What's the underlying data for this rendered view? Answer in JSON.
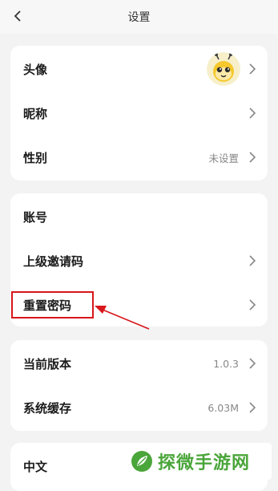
{
  "header": {
    "title": "设置"
  },
  "profile_card": {
    "avatar_label": "头像",
    "nickname_label": "昵称",
    "gender_label": "性别",
    "gender_value": "未设置"
  },
  "account_card": {
    "account_label": "账号",
    "invite_code_label": "上级邀请码",
    "reset_password_label": "重置密码"
  },
  "system_card": {
    "version_label": "当前版本",
    "version_value": "1.0.3",
    "cache_label": "系统缓存",
    "cache_value": "6.03M"
  },
  "language_card": {
    "language_label": "中文"
  },
  "watermark": {
    "text": "探微手游网",
    "color": "#4aa53a"
  },
  "colors": {
    "annotation": "#d8161b",
    "background": "#f3f3f3",
    "card": "#ffffff"
  }
}
